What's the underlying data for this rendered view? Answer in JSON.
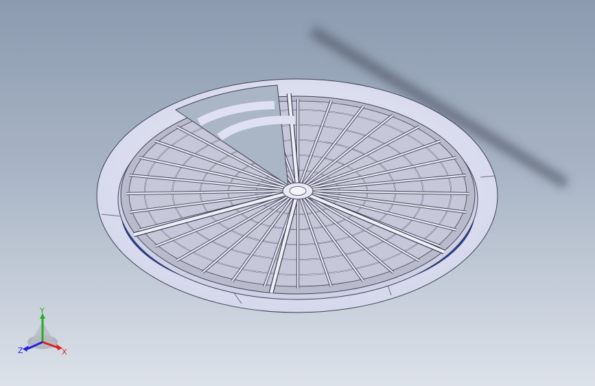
{
  "viewport": {
    "background_top": "#8c9bb0",
    "background_bottom": "#dde2ea"
  },
  "model": {
    "type": "circular radial frame assembly",
    "ring_color": "#dfe1f2",
    "frame_color": "#b9bbcc",
    "beam_color": "#e6e7f3",
    "edge_color": "#3d3f52",
    "base_plate_color": "#2a3f9e",
    "radial_beam_count": 32,
    "concentric_rings": 5,
    "sectors": [
      "left-sector",
      "right-sector",
      "front-sector"
    ]
  },
  "triad": {
    "x_label": "X",
    "y_label": "Y",
    "z_label": "Z",
    "x_color": "#e02020",
    "y_color": "#20b020",
    "z_color": "#2020e0"
  }
}
